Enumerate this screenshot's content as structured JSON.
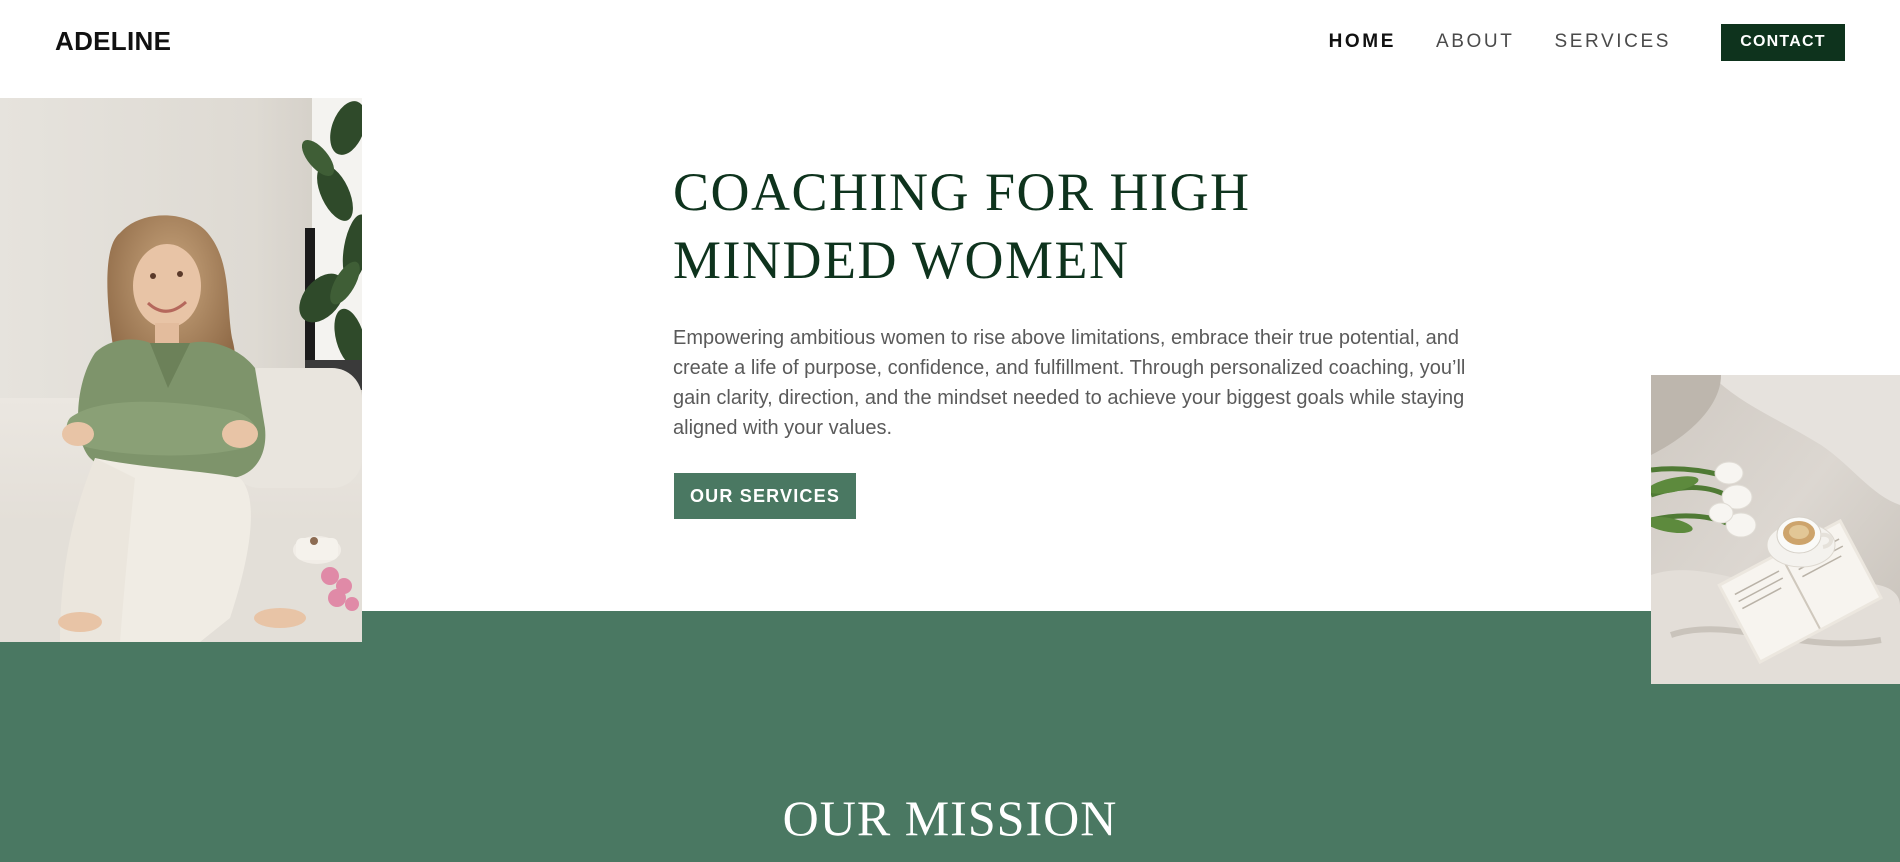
{
  "header": {
    "logo": "ADELINE",
    "nav": [
      {
        "label": "HOME",
        "active": true
      },
      {
        "label": "ABOUT",
        "active": false
      },
      {
        "label": "SERVICES",
        "active": false
      }
    ],
    "contact_label": "CONTACT"
  },
  "hero": {
    "title_line1": "COACHING FOR HIGH",
    "title_line2": "MINDED WOMEN",
    "description": "Empowering ambitious women to rise above limitations, embrace their true potential, and create a life of purpose, confidence, and fulfillment. Through personalized coaching, you’ll gain clarity, direction, and the mindset needed to achieve your biggest goals while staying aligned with your values.",
    "cta_label": "OUR SERVICES"
  },
  "mission": {
    "title": "OUR MISSION"
  },
  "colors": {
    "brand_dark_green": "#0e331d",
    "brand_green": "#4a7862",
    "body_text": "#5a5a5a"
  }
}
